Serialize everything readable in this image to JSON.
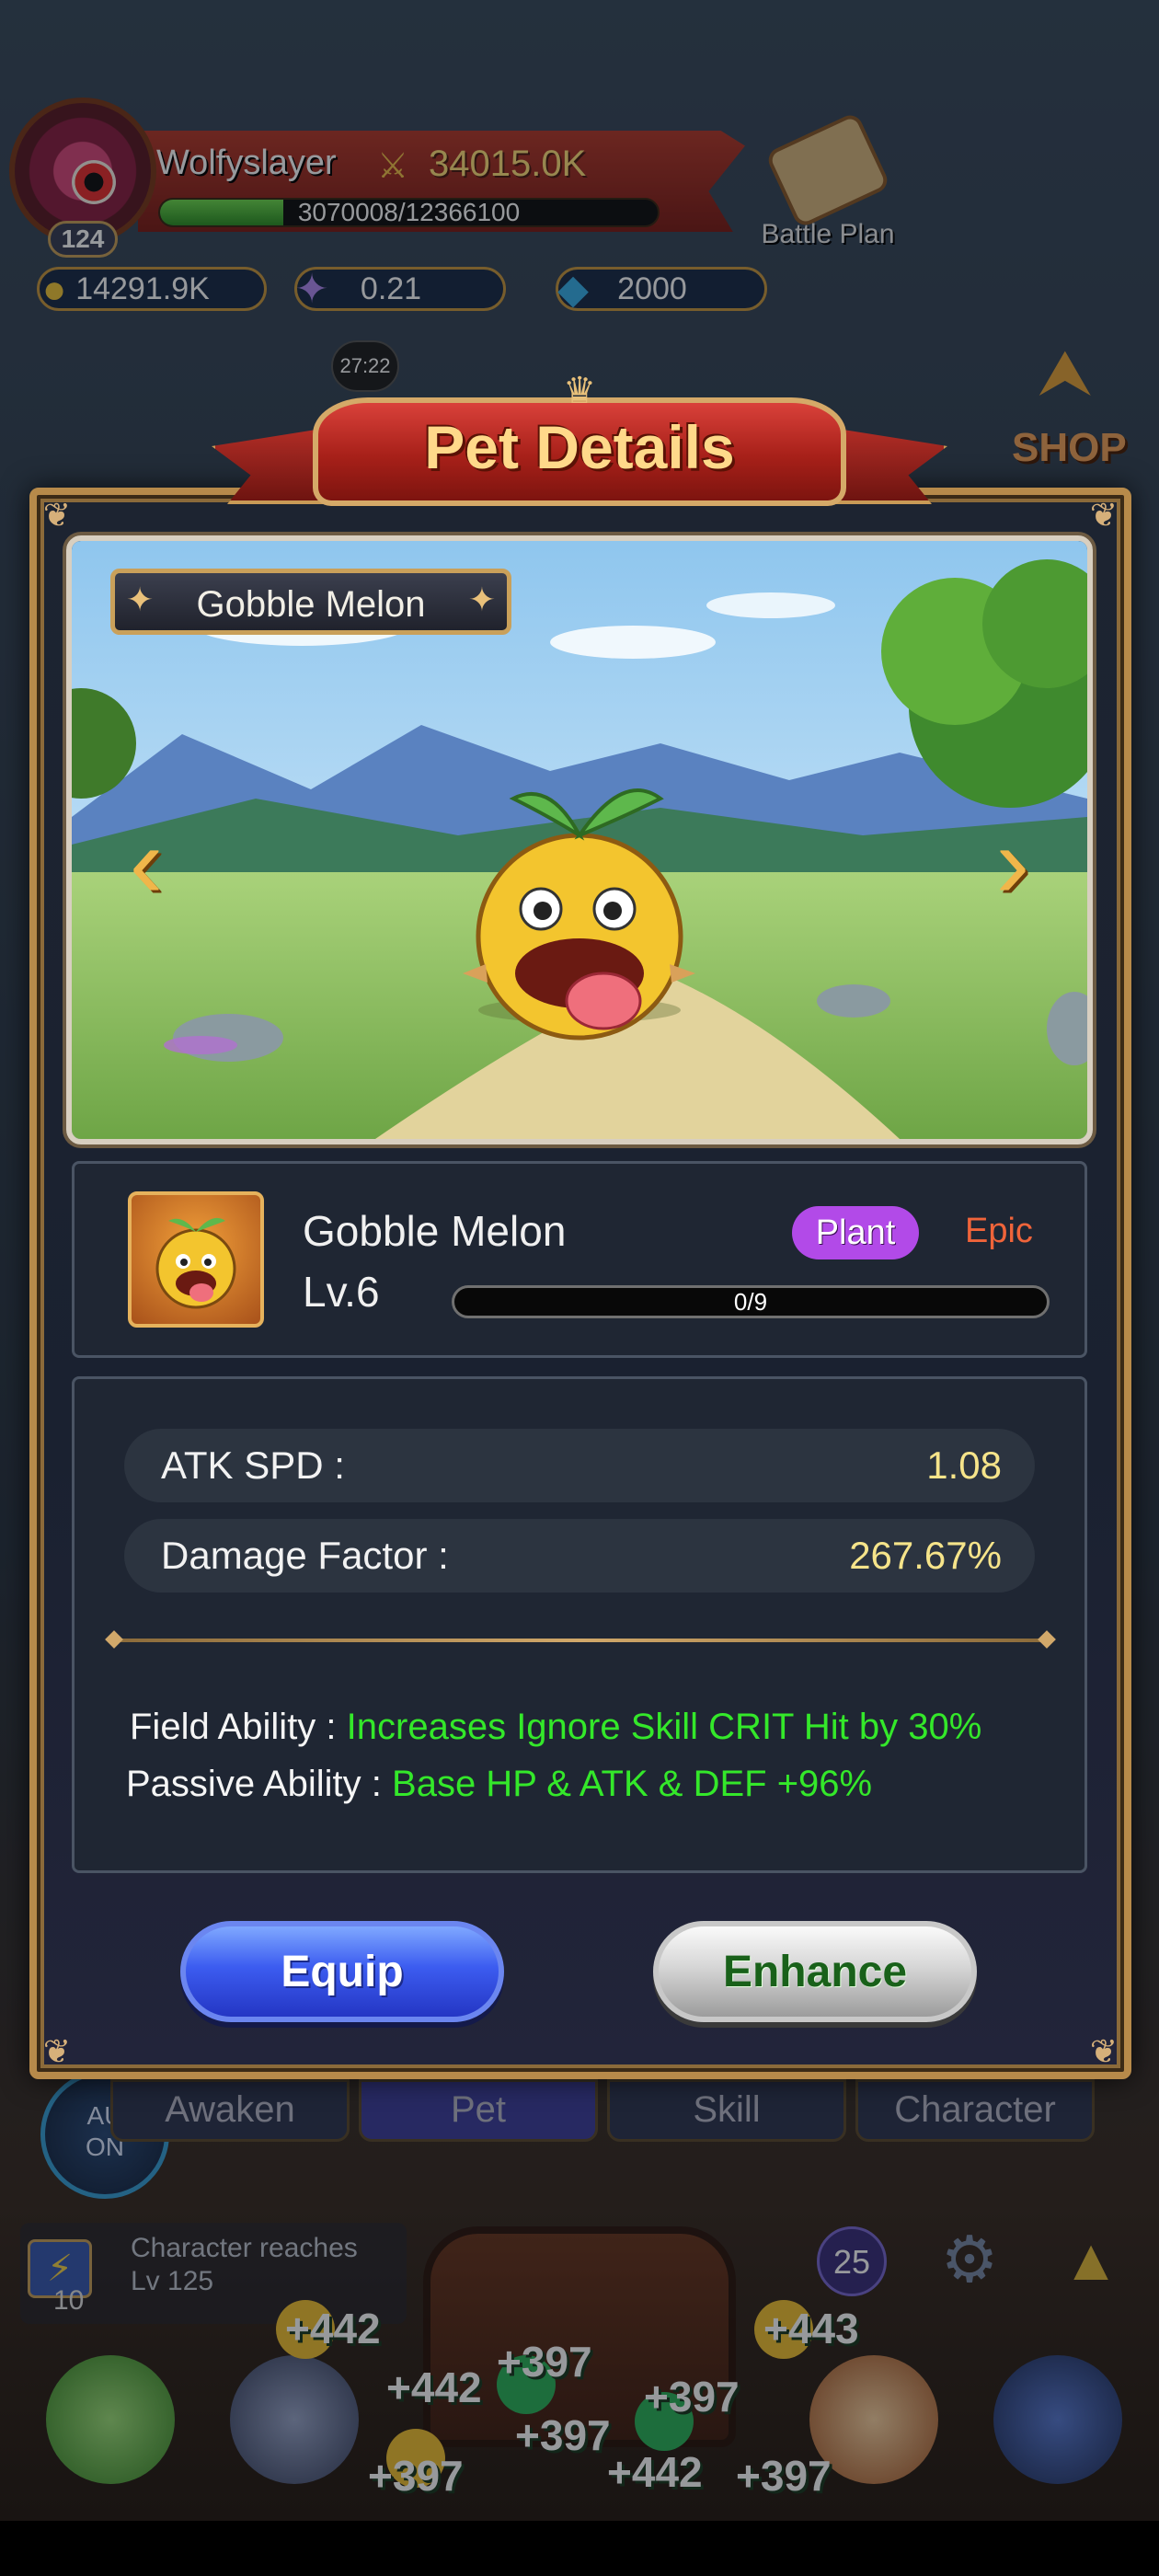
{
  "player": {
    "name": "Wolfyslayer",
    "level": "124",
    "power": "34015.0K",
    "xp_text": "3070008/12366100",
    "xp_fraction": 0.248,
    "power_icon": "crossed-swords-icon",
    "battle_plan_label": "Battle Plan"
  },
  "currencies": [
    {
      "icon": "gold-coin-icon",
      "value": "14291.9K"
    },
    {
      "icon": "star-fragment-icon",
      "value": "0.21"
    },
    {
      "icon": "blue-gem-icon",
      "value": "2000"
    }
  ],
  "event": {
    "timer": "27:22"
  },
  "shop_label": "SHOP",
  "modal": {
    "title": "Pet Details",
    "scene_pet_name": "Gobble Melon",
    "pet": {
      "name": "Gobble Melon",
      "level": "Lv.6",
      "type": "Plant",
      "rarity": "Epic",
      "progress_text": "0/9",
      "progress_fraction": 0
    },
    "stats": [
      {
        "label": "ATK SPD :",
        "value": "1.08"
      },
      {
        "label": "Damage Factor :",
        "value": "267.67%"
      }
    ],
    "abilities": [
      {
        "label": "Field Ability :",
        "value": "Increases Ignore Skill CRIT Hit by 30%"
      },
      {
        "label": "Passive Ability :",
        "value": "Base HP & ATK & DEF +96%"
      }
    ],
    "buttons": {
      "equip": "Equip",
      "enhance": "Enhance"
    }
  },
  "bottom": {
    "auto_label": "AU\nON",
    "tabs": [
      "Awaken",
      "Pet",
      "Skill",
      "Character"
    ],
    "active_tab": "Pet",
    "quest": {
      "text_line1": "Character reaches",
      "text_line2": "Lv 125",
      "count": "10"
    },
    "badge_count": "25",
    "floating_gains": [
      "+442",
      "+443",
      "+442",
      "+397",
      "+397",
      "+397",
      "+397",
      "+442",
      "+397"
    ]
  },
  "colors": {
    "accent_gold": "#b78a4a",
    "epic": "#f0643a",
    "plant_badge": "#b24ae8",
    "ability_green": "#34e82a",
    "stat_value": "#f6e48a"
  }
}
